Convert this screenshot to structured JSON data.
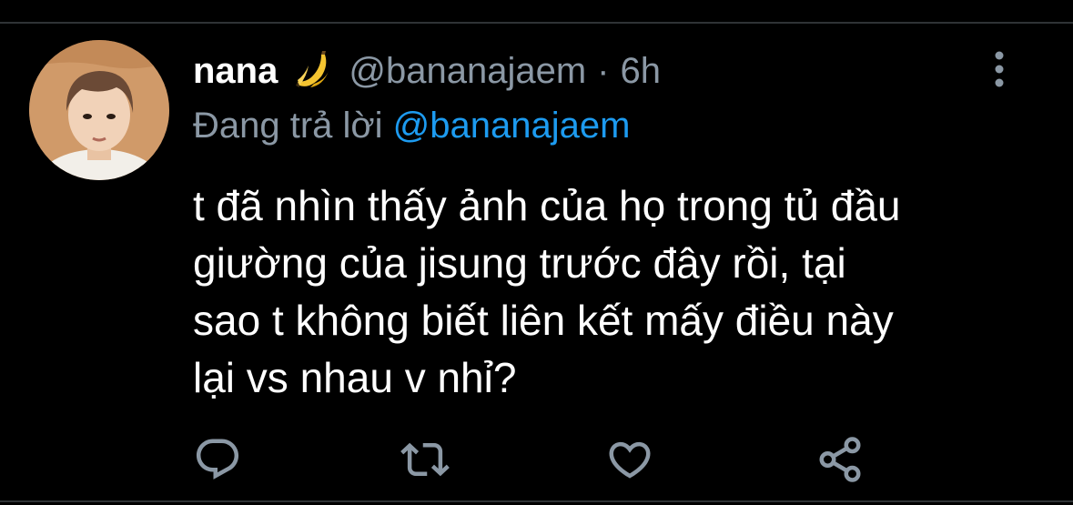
{
  "tweet": {
    "author_name": "nana",
    "author_emoji": "banana-emoji",
    "handle": "@bananajaem",
    "separator": "·",
    "time": "6h",
    "reply_prefix": "Đang trả lời",
    "reply_to": "@bananajaem",
    "body_lines": [
      "t đã nhìn thấy ảnh của họ trong tủ đầu",
      "giường của jisung trước đây rồi, tại",
      "sao t không biết liên kết mấy điều này",
      "lại vs nhau v nhỉ?"
    ]
  },
  "actions": [
    {
      "icon": "reply-icon"
    },
    {
      "icon": "retweet-icon"
    },
    {
      "icon": "like-icon"
    },
    {
      "icon": "share-icon"
    }
  ],
  "colors": {
    "background": "#000000",
    "text_primary": "#ffffff",
    "text_secondary": "#8b98a5",
    "accent": "#1d9bf0",
    "divider": "#2f3336"
  }
}
